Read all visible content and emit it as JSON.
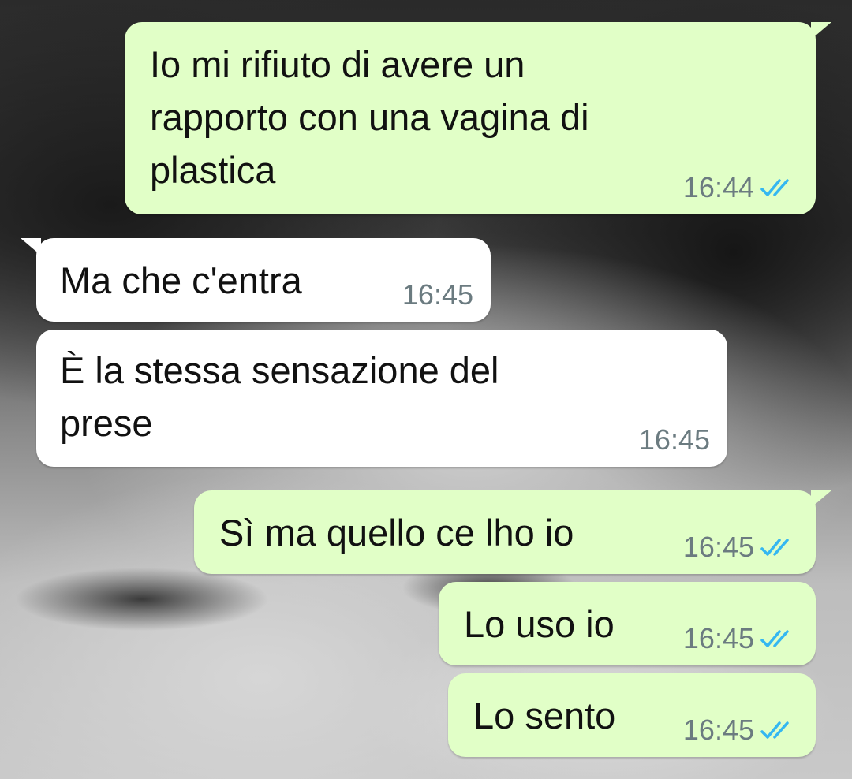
{
  "chat": {
    "messages": [
      {
        "direction": "outgoing",
        "text": "Io mi rifiuto di avere un\nrapporto con una vagina di\nplastica",
        "time": "16:44",
        "status": "read"
      },
      {
        "direction": "incoming",
        "text": "Ma che c'entra",
        "time": "16:45"
      },
      {
        "direction": "incoming",
        "text": "È la stessa sensazione del\nprese",
        "time": "16:45"
      },
      {
        "direction": "outgoing",
        "text": "Sì ma quello ce lho io",
        "time": "16:45",
        "status": "read"
      },
      {
        "direction": "outgoing",
        "text": "Lo uso io",
        "time": "16:45",
        "status": "read"
      },
      {
        "direction": "outgoing",
        "text": "Lo sento",
        "time": "16:45",
        "status": "read"
      }
    ]
  },
  "colors": {
    "outgoing_bubble": "#e1ffc7",
    "incoming_bubble": "#ffffff",
    "read_ticks": "#34b7f1",
    "timestamp": "#6b7b80"
  },
  "icons": {
    "read_status": "double-check-icon"
  }
}
